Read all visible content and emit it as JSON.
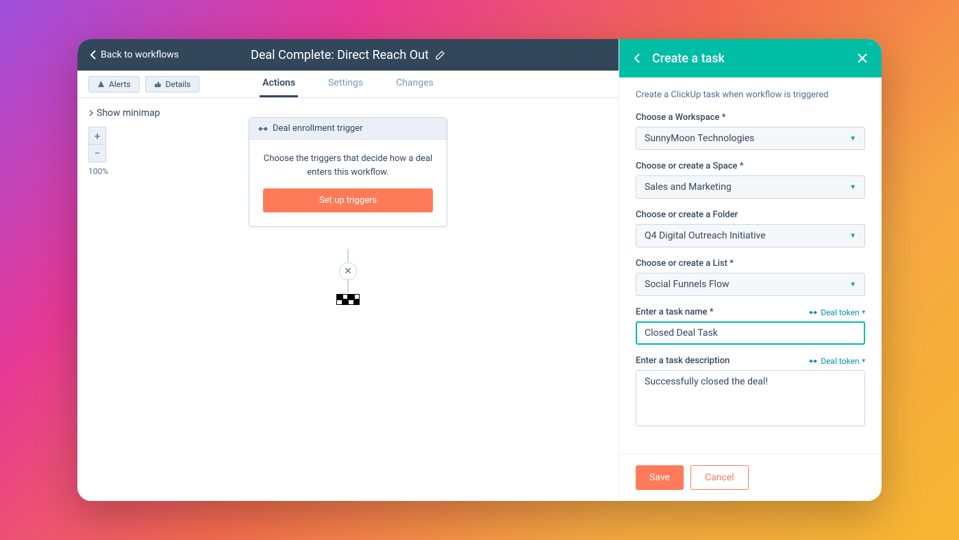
{
  "topbar": {
    "back_label": "Back to workflows",
    "title": "Deal Complete: Direct Reach Out"
  },
  "subbar": {
    "alerts_label": "Alerts",
    "details_label": "Details",
    "tabs": {
      "actions": "Actions",
      "settings": "Settings",
      "changes": "Changes"
    }
  },
  "canvas": {
    "minimap_label": "Show minimap",
    "zoom_label": "100%",
    "trigger_title": "Deal enrollment trigger",
    "trigger_desc": "Choose the triggers that decide how a deal enters this workflow.",
    "trigger_button": "Set up triggers"
  },
  "panel": {
    "title": "Create a task",
    "description": "Create a ClickUp task when workflow is triggered",
    "deal_token_label": "Deal token",
    "fields": {
      "workspace": {
        "label": "Choose a Workspace *",
        "value": "SunnyMoon Technologies"
      },
      "space": {
        "label": "Choose or create a Space *",
        "value": "Sales and Marketing"
      },
      "folder": {
        "label": "Choose or create a Folder",
        "value": "Q4 Digital Outreach Initiative"
      },
      "list": {
        "label": "Choose or create a List *",
        "value": "Social Funnels Flow"
      },
      "task_name": {
        "label": "Enter a task name *",
        "value": "Closed Deal Task"
      },
      "task_desc": {
        "label": "Enter a task description",
        "value": "Successfully closed the deal!"
      }
    },
    "save_label": "Save",
    "cancel_label": "Cancel"
  }
}
